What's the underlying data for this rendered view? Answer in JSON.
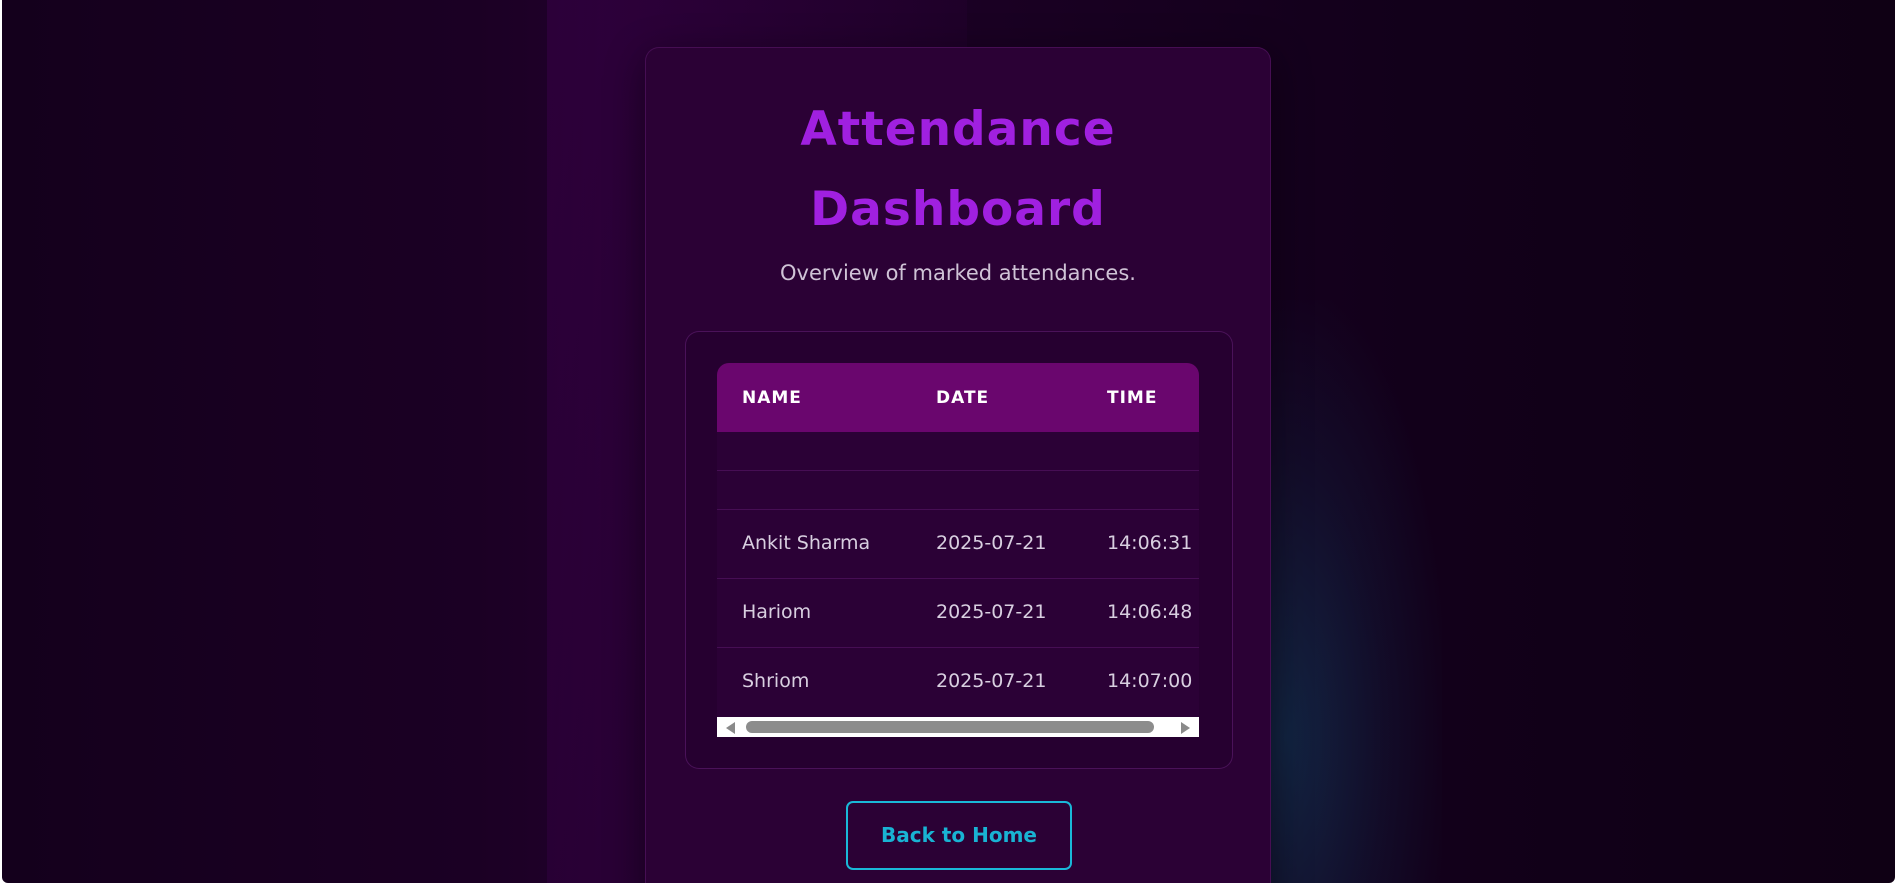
{
  "page": {
    "title_line1": "Attendance",
    "title_line2": "Dashboard",
    "subtitle": "Overview of marked attendances."
  },
  "table": {
    "headers": [
      "NAME",
      "DATE",
      "TIME"
    ],
    "rows": [
      {
        "name": "",
        "date": "",
        "time": ""
      },
      {
        "name": "",
        "date": "",
        "time": ""
      },
      {
        "name": "Ankit Sharma",
        "date": "2025-07-21",
        "time": "14:06:31"
      },
      {
        "name": "Hariom",
        "date": "2025-07-21",
        "time": "14:06:48"
      },
      {
        "name": "Shriom",
        "date": "2025-07-21",
        "time": "14:07:00"
      }
    ]
  },
  "actions": {
    "back_label": "Back to Home"
  },
  "colors": {
    "accent_title": "#a020e0",
    "header_bg": "#6a066e",
    "button_accent": "#19b3d3",
    "card_bg": "#2b0135"
  }
}
